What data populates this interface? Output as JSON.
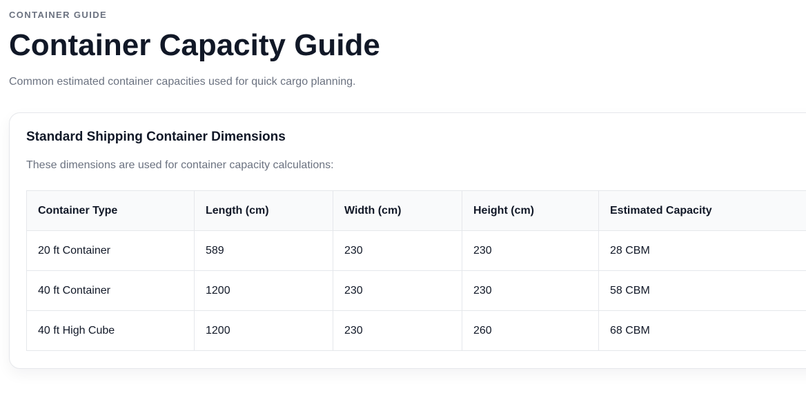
{
  "header": {
    "eyebrow": "CONTAINER GUIDE",
    "title": "Container Capacity Guide",
    "subtitle": "Common estimated container capacities used for quick cargo planning."
  },
  "card": {
    "title": "Standard Shipping Container Dimensions",
    "description": "These dimensions are used for container capacity calculations:"
  },
  "table": {
    "columns": [
      "Container Type",
      "Length (cm)",
      "Width (cm)",
      "Height (cm)",
      "Estimated Capacity"
    ],
    "rows": [
      [
        "20 ft Container",
        "589",
        "230",
        "230",
        "28 CBM"
      ],
      [
        "40 ft Container",
        "1200",
        "230",
        "230",
        "58 CBM"
      ],
      [
        "40 ft High Cube",
        "1200",
        "230",
        "260",
        "68 CBM"
      ]
    ]
  },
  "colors": {
    "text_primary": "#111827",
    "text_muted": "#6b7280",
    "border": "#e5e7eb",
    "header_bg": "#f9fafb"
  }
}
